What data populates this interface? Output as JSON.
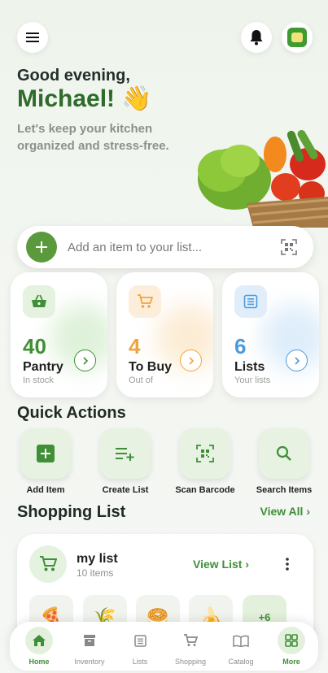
{
  "header": {
    "greeting": "Good evening,",
    "name": "Michael! 👋",
    "subtitle": "Let's keep your kitchen organized and stress-free."
  },
  "search": {
    "placeholder": "Add an item to your list..."
  },
  "stats": [
    {
      "count": "40",
      "label": "Pantry",
      "caption": "In stock",
      "color": "#3f8f37"
    },
    {
      "count": "4",
      "label": "To Buy",
      "caption": "Out of",
      "color": "#f0a43a"
    },
    {
      "count": "6",
      "label": "Lists",
      "caption": "Your lists",
      "color": "#4b9bdc"
    }
  ],
  "quick_actions": {
    "title": "Quick Actions",
    "items": [
      {
        "label": "Add Item",
        "icon": "plus-square-icon"
      },
      {
        "label": "Create List",
        "icon": "playlist-add-icon"
      },
      {
        "label": "Scan Barcode",
        "icon": "qr-scan-icon"
      },
      {
        "label": "Search Items",
        "icon": "search-icon"
      }
    ]
  },
  "shopping": {
    "title": "Shopping List",
    "view_all": "View All ›",
    "list": {
      "name": "my list",
      "count": "10 items",
      "view_list": "View List ›",
      "thumbs": [
        "🍕",
        "🌾",
        "🥯",
        "🍌"
      ],
      "more": "+6"
    }
  },
  "nav": [
    {
      "label": "Home",
      "active": true
    },
    {
      "label": "Inventory"
    },
    {
      "label": "Lists"
    },
    {
      "label": "Shopping"
    },
    {
      "label": "Catalog"
    },
    {
      "label": "More",
      "active": true
    }
  ],
  "colors": {
    "accent": "#3f8f37",
    "accent_dark": "#2f6b2a",
    "orange": "#f0a43a",
    "blue": "#4b9bdc"
  }
}
